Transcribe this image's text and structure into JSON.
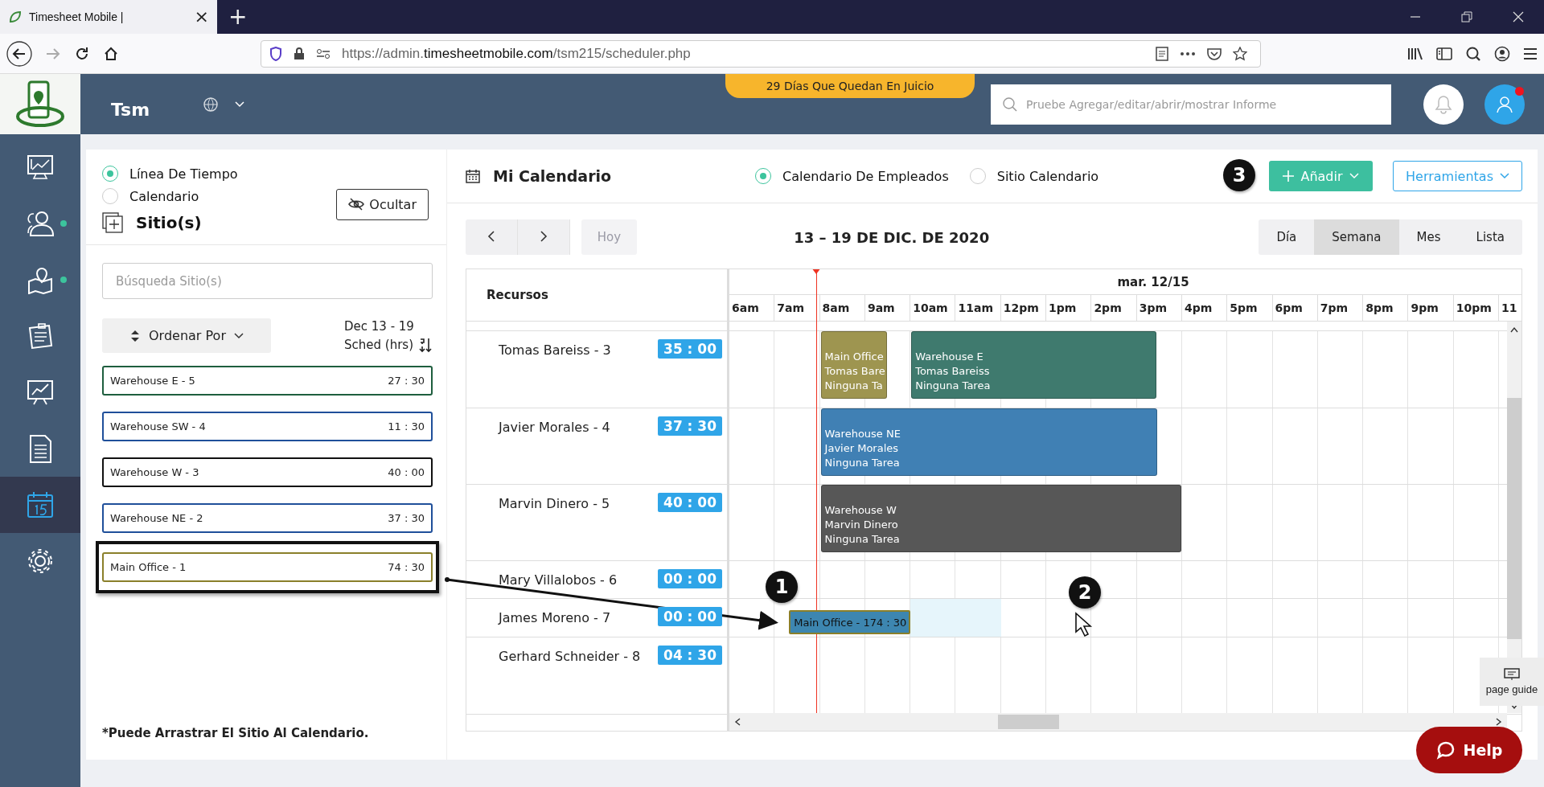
{
  "browser": {
    "tab": {
      "title": "Timesheet Mobile |",
      "close": "×"
    },
    "new_tab": "+",
    "url": {
      "parts": [
        {
          "text": "https://admin.",
          "kind": "dim"
        },
        {
          "text": "timesheetmobile.com",
          "kind": "host"
        },
        {
          "text": "/tsm215/scheduler.php",
          "kind": "dim"
        }
      ]
    }
  },
  "app_header": {
    "brand": "Tsm",
    "trial_banner": "29 Días Que Quedan En Juicio",
    "search": {
      "placeholder": "Pruebe Agregar/editar/abrir/mostrar Informe"
    },
    "alert": true
  },
  "sidebar": {
    "items": [
      {
        "kind": "dashboard",
        "selected": false,
        "dot": false
      },
      {
        "kind": "people",
        "selected": false,
        "dot": true
      },
      {
        "kind": "map",
        "selected": false,
        "dot": true
      },
      {
        "kind": "clipboard",
        "selected": false,
        "dot": false
      },
      {
        "kind": "chart",
        "selected": false,
        "dot": false
      },
      {
        "kind": "document",
        "selected": false,
        "dot": false
      },
      {
        "kind": "calendar",
        "selected": true,
        "dot": false
      },
      {
        "kind": "settings",
        "selected": false,
        "dot": false
      }
    ]
  },
  "site_panel": {
    "view_options": [
      {
        "label": "Línea De Tiempo",
        "selected": true
      },
      {
        "label": "Calendario",
        "selected": false
      }
    ],
    "hide_button": "Ocultar",
    "title": "Sitio(s)",
    "search": {
      "placeholder": "Búsqueda Sitio(s)"
    },
    "sort_button": "Ordenar Por",
    "range_label": "Dec 13 - 19",
    "sched_label": "Sched (hrs)",
    "sites": [
      {
        "name": "Warehouse E - 5",
        "hours": "27 : 30",
        "color": "#1e5e3e",
        "highlighted": false
      },
      {
        "name": "Warehouse SW - 4",
        "hours": "11 : 30",
        "color": "#1f4f9a",
        "highlighted": false
      },
      {
        "name": "Warehouse W - 3",
        "hours": "40 : 00",
        "color": "#111111",
        "highlighted": false
      },
      {
        "name": "Warehouse NE - 2",
        "hours": "37 : 30",
        "color": "#1f4f9a",
        "highlighted": false
      },
      {
        "name": "Main Office - 1",
        "hours": "74 : 30",
        "color": "#8a7f2a",
        "highlighted": true
      }
    ],
    "note": "*Puede Arrastrar El Sitio Al Calendario."
  },
  "calendar": {
    "title": "Mi Calendario",
    "modes": [
      {
        "label": "Calendario De Empleados",
        "selected": true
      },
      {
        "label": "Sitio Calendario",
        "selected": false
      }
    ],
    "add_button": "Añadir",
    "tools_button": "Herramientas",
    "today_button": {
      "label": "Hoy",
      "disabled": true
    },
    "range_title": "13 – 19 DE DIC. DE 2020",
    "views": [
      {
        "label": "Día",
        "selected": false
      },
      {
        "label": "Semana",
        "selected": true
      },
      {
        "label": "Mes",
        "selected": false
      },
      {
        "label": "Lista",
        "selected": false
      }
    ],
    "resources_header": "Recursos",
    "day_label": "mar. 12/15",
    "hours": [
      "6am",
      "7am",
      "8am",
      "9am",
      "10am",
      "11am",
      "12pm",
      "1pm",
      "2pm",
      "3pm",
      "4pm",
      "5pm",
      "6pm",
      "7pm",
      "8pm",
      "9pm",
      "10pm",
      "11"
    ],
    "resources": [
      {
        "name": "Tomas Bareiss - 3",
        "total": "35 : 00",
        "shifts": [
          {
            "lines": [
              "Main Office",
              "Tomas Bare",
              "Ninguna Ta"
            ],
            "color": "#9e9550"
          },
          {
            "lines": [
              "Warehouse E",
              "Tomas Bareiss",
              "Ninguna Tarea"
            ],
            "color": "#3f7a6e"
          }
        ]
      },
      {
        "name": "Javier Morales - 4",
        "total": "37 : 30",
        "shifts": [
          {
            "lines": [
              "Warehouse NE",
              "Javier Morales",
              "Ninguna Tarea"
            ],
            "color": "#4080b4"
          }
        ]
      },
      {
        "name": "Marvin Dinero - 5",
        "total": "40 : 00",
        "shifts": [
          {
            "lines": [
              "Warehouse W",
              "Marvin Dinero",
              "Ninguna Tarea"
            ],
            "color": "#575757"
          }
        ]
      },
      {
        "name": "Mary Villalobos - 6",
        "total": "00 : 00"
      },
      {
        "name": "James Moreno - 7",
        "total": "00 : 00"
      },
      {
        "name": "Gerhard Schneider - 8",
        "total": "04 : 30"
      }
    ],
    "dragged_shift": {
      "label": "Main Office - 174 : 30"
    }
  },
  "annotations": [
    {
      "label": "1"
    },
    {
      "label": "2"
    },
    {
      "label": "3"
    }
  ],
  "page_guide": "page guide",
  "help_button": "Help"
}
